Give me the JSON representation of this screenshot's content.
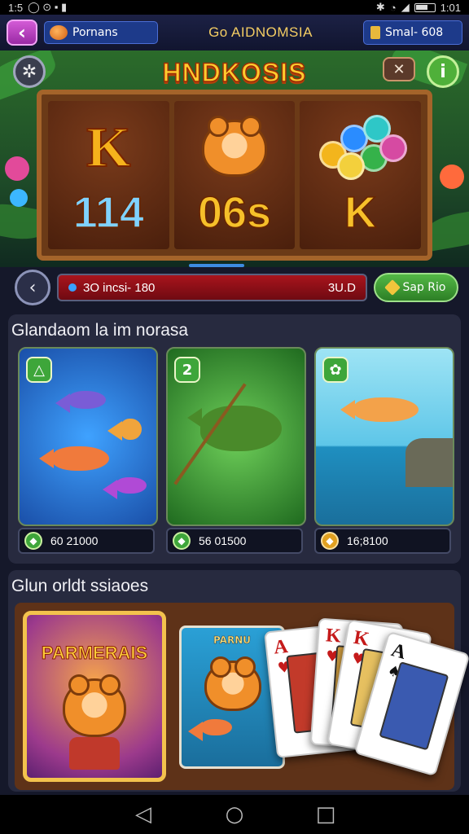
{
  "status_bar": {
    "left_text": "1:5",
    "time": "1:01"
  },
  "header": {
    "profile_name": "Pornans",
    "title": "Go AIDNOMSIA",
    "wallet_label": "Smal- 608"
  },
  "slot": {
    "logo_text": "HNDKOSIS",
    "reels": [
      {
        "symbol_text": "K",
        "value": "114",
        "value_color": "blue"
      },
      {
        "symbol_text": "",
        "value": "06s",
        "value_color": "gold"
      },
      {
        "symbol_text": "",
        "value": "K",
        "value_color": "gold"
      }
    ],
    "bet_left": "3O incsi- 180",
    "bet_right": "3U.D",
    "spin_label": "Sap Rio"
  },
  "fishing_section": {
    "title": "Glandaom la im norasa",
    "cards": [
      {
        "badge": "△",
        "price": "60 21000",
        "theme": "blue"
      },
      {
        "badge": "2",
        "price": "56 01500",
        "theme": "green"
      },
      {
        "badge": "✿",
        "price": "16;8100",
        "theme": "sea"
      }
    ]
  },
  "promo_section": {
    "title": "Glun orldt ssiaoes",
    "promo_banner": "PARMERAIS",
    "promo_card_label": "PARNU",
    "playing_cards": [
      {
        "rank": "A",
        "suit": "♥",
        "color": "#c51a1a"
      },
      {
        "rank": "K",
        "suit": "♥",
        "color": "#c51a1a"
      },
      {
        "rank": "K",
        "suit": "♥",
        "color": "#c51a1a"
      },
      {
        "rank": "A",
        "suit": "♠",
        "color": "#111111"
      }
    ]
  },
  "nav": {
    "back_icon": "◁",
    "home_icon": "○",
    "recents_icon": "□"
  }
}
